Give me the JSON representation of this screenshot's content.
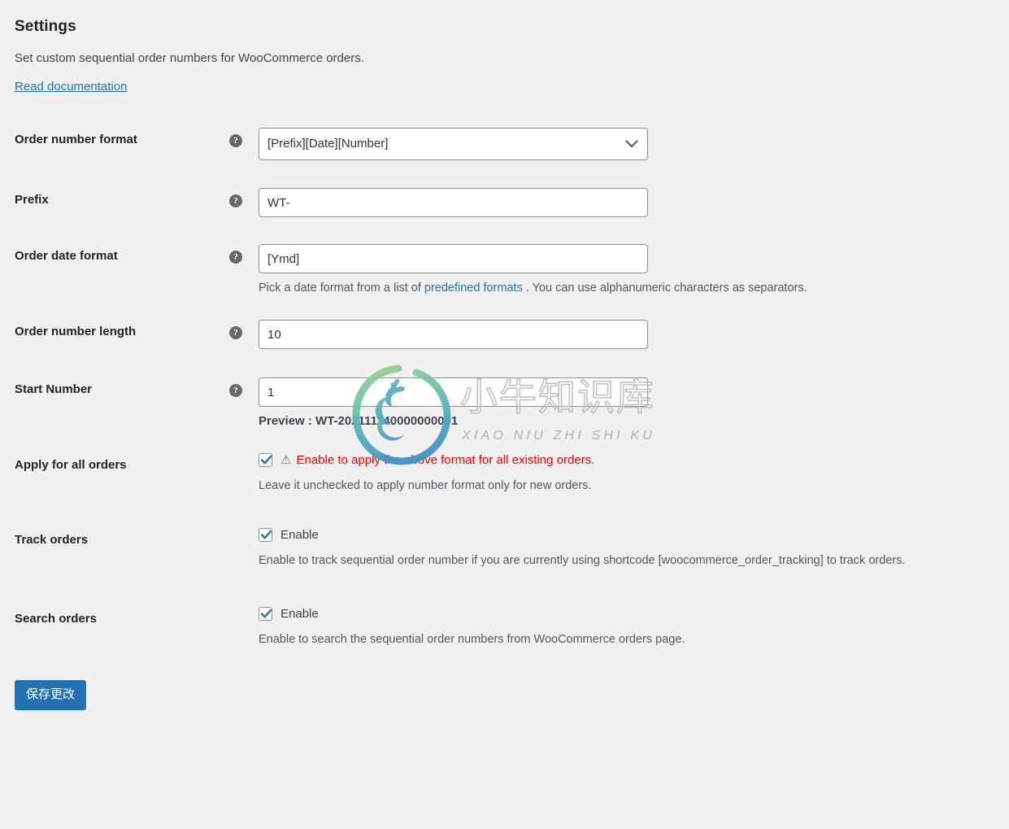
{
  "header": {
    "title": "Settings",
    "subtitle": "Set custom sequential order numbers for WooCommerce orders.",
    "doc_link": "Read documentation"
  },
  "fields": {
    "order_number_format": {
      "label": "Order number format",
      "value": "[Prefix][Date][Number]",
      "help": "?"
    },
    "prefix": {
      "label": "Prefix",
      "value": "WT-",
      "help": "?"
    },
    "order_date_format": {
      "label": "Order date format",
      "value": "[Ymd]",
      "help": "?",
      "hint_before": "Pick a date format from a list of ",
      "hint_link": "predefined formats",
      "hint_after": " . You can use alphanumeric characters as separators."
    },
    "order_number_length": {
      "label": "Order number length",
      "value": "10",
      "help": "?"
    },
    "start_number": {
      "label": "Start Number",
      "value": "1",
      "help": "?",
      "preview": "Preview : WT-202111140000000001"
    },
    "apply_all_orders": {
      "label": "Apply for all orders",
      "checked": true,
      "warning_icon": "warning-triangle",
      "warning_text": "Enable to apply the above format for all existing orders.",
      "description": "Leave it unchecked to apply number format only for new orders."
    },
    "track_orders": {
      "label": "Track orders",
      "checked": true,
      "checkbox_label": "Enable",
      "description": "Enable to track sequential order number if you are currently using shortcode [woocommerce_order_tracking] to track orders."
    },
    "search_orders": {
      "label": "Search orders",
      "checked": true,
      "checkbox_label": "Enable",
      "description": "Enable to search the sequential order numbers from WooCommerce orders page."
    }
  },
  "actions": {
    "save_label": "保存更改"
  },
  "watermark": {
    "cn_text": "小牛知识库",
    "pinyin_text": "XIAO NIU ZHI SHI KU",
    "color_top": "#8cc878",
    "color_bottom": "#4a9bc9"
  },
  "colors": {
    "background": "#f0f0f1",
    "accent": "#2271b1",
    "warning": "#ff0000",
    "label": "#1d2327"
  }
}
